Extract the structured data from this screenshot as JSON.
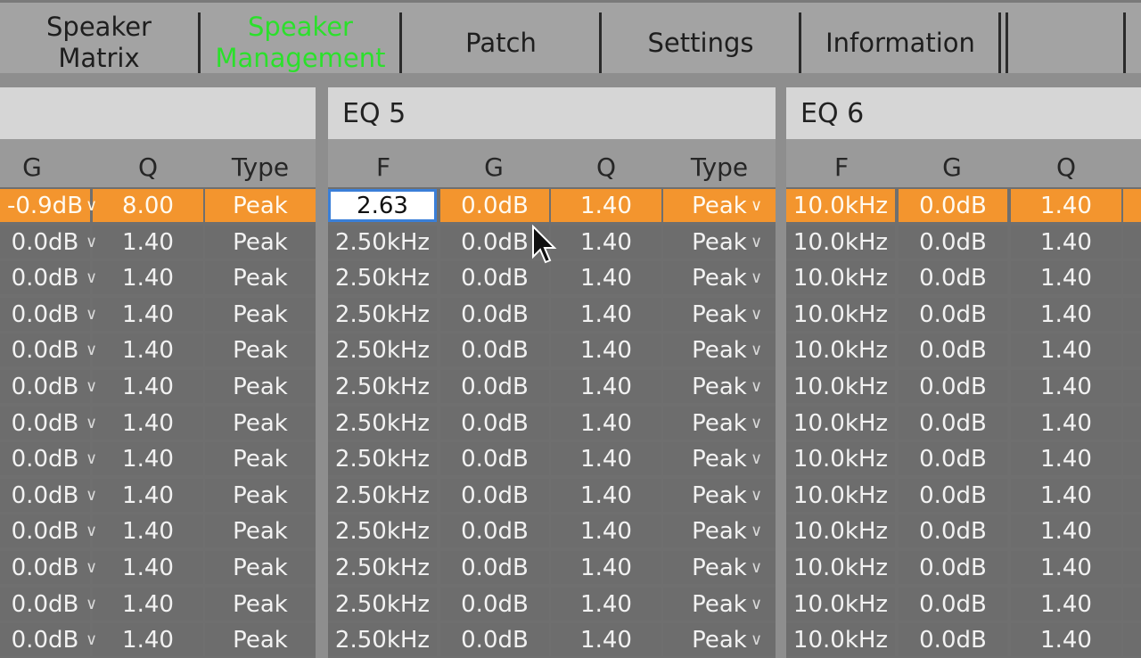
{
  "tabs": [
    {
      "label": "Speaker\nMatrix",
      "active": false
    },
    {
      "label": "Speaker\nManagement",
      "active": true
    },
    {
      "label": "Patch",
      "active": false
    },
    {
      "label": "Settings",
      "active": false
    },
    {
      "label": "Information",
      "active": false
    },
    {
      "label": "",
      "active": false
    }
  ],
  "colors": {
    "selected_row": "#f3952e",
    "active_tab": "#2be02b",
    "edit_border": "#3a7fd8"
  },
  "eq4": {
    "title": "",
    "columns": [
      "G",
      "Q",
      "Type"
    ],
    "rows": [
      {
        "g": "-0.9dB",
        "q": "8.00",
        "type": "Peak"
      },
      {
        "g": "0.0dB",
        "q": "1.40",
        "type": "Peak"
      },
      {
        "g": "0.0dB",
        "q": "1.40",
        "type": "Peak"
      },
      {
        "g": "0.0dB",
        "q": "1.40",
        "type": "Peak"
      },
      {
        "g": "0.0dB",
        "q": "1.40",
        "type": "Peak"
      },
      {
        "g": "0.0dB",
        "q": "1.40",
        "type": "Peak"
      },
      {
        "g": "0.0dB",
        "q": "1.40",
        "type": "Peak"
      },
      {
        "g": "0.0dB",
        "q": "1.40",
        "type": "Peak"
      },
      {
        "g": "0.0dB",
        "q": "1.40",
        "type": "Peak"
      },
      {
        "g": "0.0dB",
        "q": "1.40",
        "type": "Peak"
      },
      {
        "g": "0.0dB",
        "q": "1.40",
        "type": "Peak"
      },
      {
        "g": "0.0dB",
        "q": "1.40",
        "type": "Peak"
      },
      {
        "g": "0.0dB",
        "q": "1.40",
        "type": "Peak"
      }
    ]
  },
  "eq5": {
    "title": "EQ 5",
    "columns": [
      "F",
      "G",
      "Q",
      "Type"
    ],
    "editing_value": "2.63",
    "rows": [
      {
        "f": "2.63",
        "g": "0.0dB",
        "q": "1.40",
        "type": "Peak"
      },
      {
        "f": "2.50kHz",
        "g": "0.0dB",
        "q": "1.40",
        "type": "Peak"
      },
      {
        "f": "2.50kHz",
        "g": "0.0dB",
        "q": "1.40",
        "type": "Peak"
      },
      {
        "f": "2.50kHz",
        "g": "0.0dB",
        "q": "1.40",
        "type": "Peak"
      },
      {
        "f": "2.50kHz",
        "g": "0.0dB",
        "q": "1.40",
        "type": "Peak"
      },
      {
        "f": "2.50kHz",
        "g": "0.0dB",
        "q": "1.40",
        "type": "Peak"
      },
      {
        "f": "2.50kHz",
        "g": "0.0dB",
        "q": "1.40",
        "type": "Peak"
      },
      {
        "f": "2.50kHz",
        "g": "0.0dB",
        "q": "1.40",
        "type": "Peak"
      },
      {
        "f": "2.50kHz",
        "g": "0.0dB",
        "q": "1.40",
        "type": "Peak"
      },
      {
        "f": "2.50kHz",
        "g": "0.0dB",
        "q": "1.40",
        "type": "Peak"
      },
      {
        "f": "2.50kHz",
        "g": "0.0dB",
        "q": "1.40",
        "type": "Peak"
      },
      {
        "f": "2.50kHz",
        "g": "0.0dB",
        "q": "1.40",
        "type": "Peak"
      },
      {
        "f": "2.50kHz",
        "g": "0.0dB",
        "q": "1.40",
        "type": "Peak"
      }
    ]
  },
  "eq6": {
    "title": "EQ 6",
    "columns": [
      "F",
      "G",
      "Q"
    ],
    "rows": [
      {
        "f": "10.0kHz",
        "g": "0.0dB",
        "q": "1.40"
      },
      {
        "f": "10.0kHz",
        "g": "0.0dB",
        "q": "1.40"
      },
      {
        "f": "10.0kHz",
        "g": "0.0dB",
        "q": "1.40"
      },
      {
        "f": "10.0kHz",
        "g": "0.0dB",
        "q": "1.40"
      },
      {
        "f": "10.0kHz",
        "g": "0.0dB",
        "q": "1.40"
      },
      {
        "f": "10.0kHz",
        "g": "0.0dB",
        "q": "1.40"
      },
      {
        "f": "10.0kHz",
        "g": "0.0dB",
        "q": "1.40"
      },
      {
        "f": "10.0kHz",
        "g": "0.0dB",
        "q": "1.40"
      },
      {
        "f": "10.0kHz",
        "g": "0.0dB",
        "q": "1.40"
      },
      {
        "f": "10.0kHz",
        "g": "0.0dB",
        "q": "1.40"
      },
      {
        "f": "10.0kHz",
        "g": "0.0dB",
        "q": "1.40"
      },
      {
        "f": "10.0kHz",
        "g": "0.0dB",
        "q": "1.40"
      },
      {
        "f": "10.0kHz",
        "g": "0.0dB",
        "q": "1.40"
      }
    ]
  }
}
